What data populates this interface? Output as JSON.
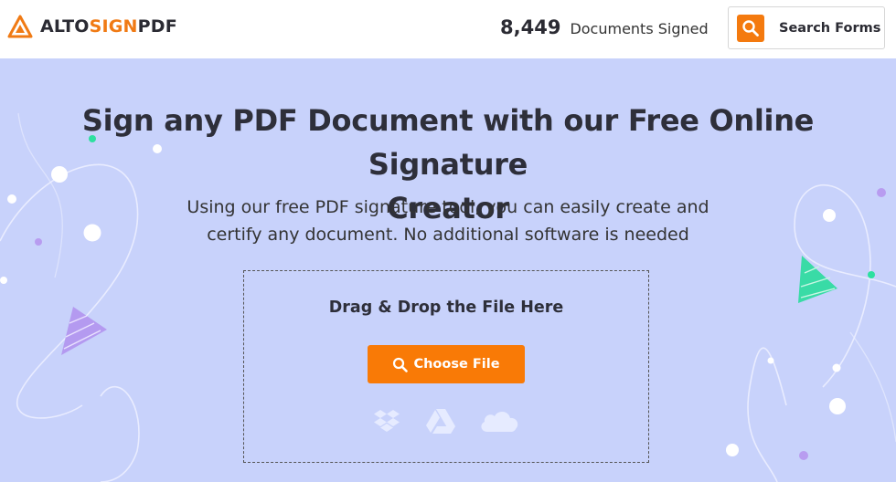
{
  "header": {
    "logo_prefix": "ALTO",
    "logo_middle": "SIGN",
    "logo_suffix": "PDF",
    "counter_value": "8,449",
    "counter_label": "Documents Signed",
    "search_button_label": "Search Forms"
  },
  "hero": {
    "title_line1": "Sign any PDF Document with our Free Online Signature",
    "title_line2": "Creator",
    "subtitle_line1": "Using our free PDF signature tool, you can easily create and",
    "subtitle_line2": "certify any document. No additional software is needed",
    "drop_label": "Drag & Drop the File Here",
    "choose_button_label": "Choose File",
    "cloud_sources": [
      "dropbox-icon",
      "google-drive-icon",
      "onedrive-icon"
    ]
  },
  "colors": {
    "accent": "#f97a06",
    "hero_background": "#c8d2fb",
    "text_dark": "#2e2f3a"
  }
}
